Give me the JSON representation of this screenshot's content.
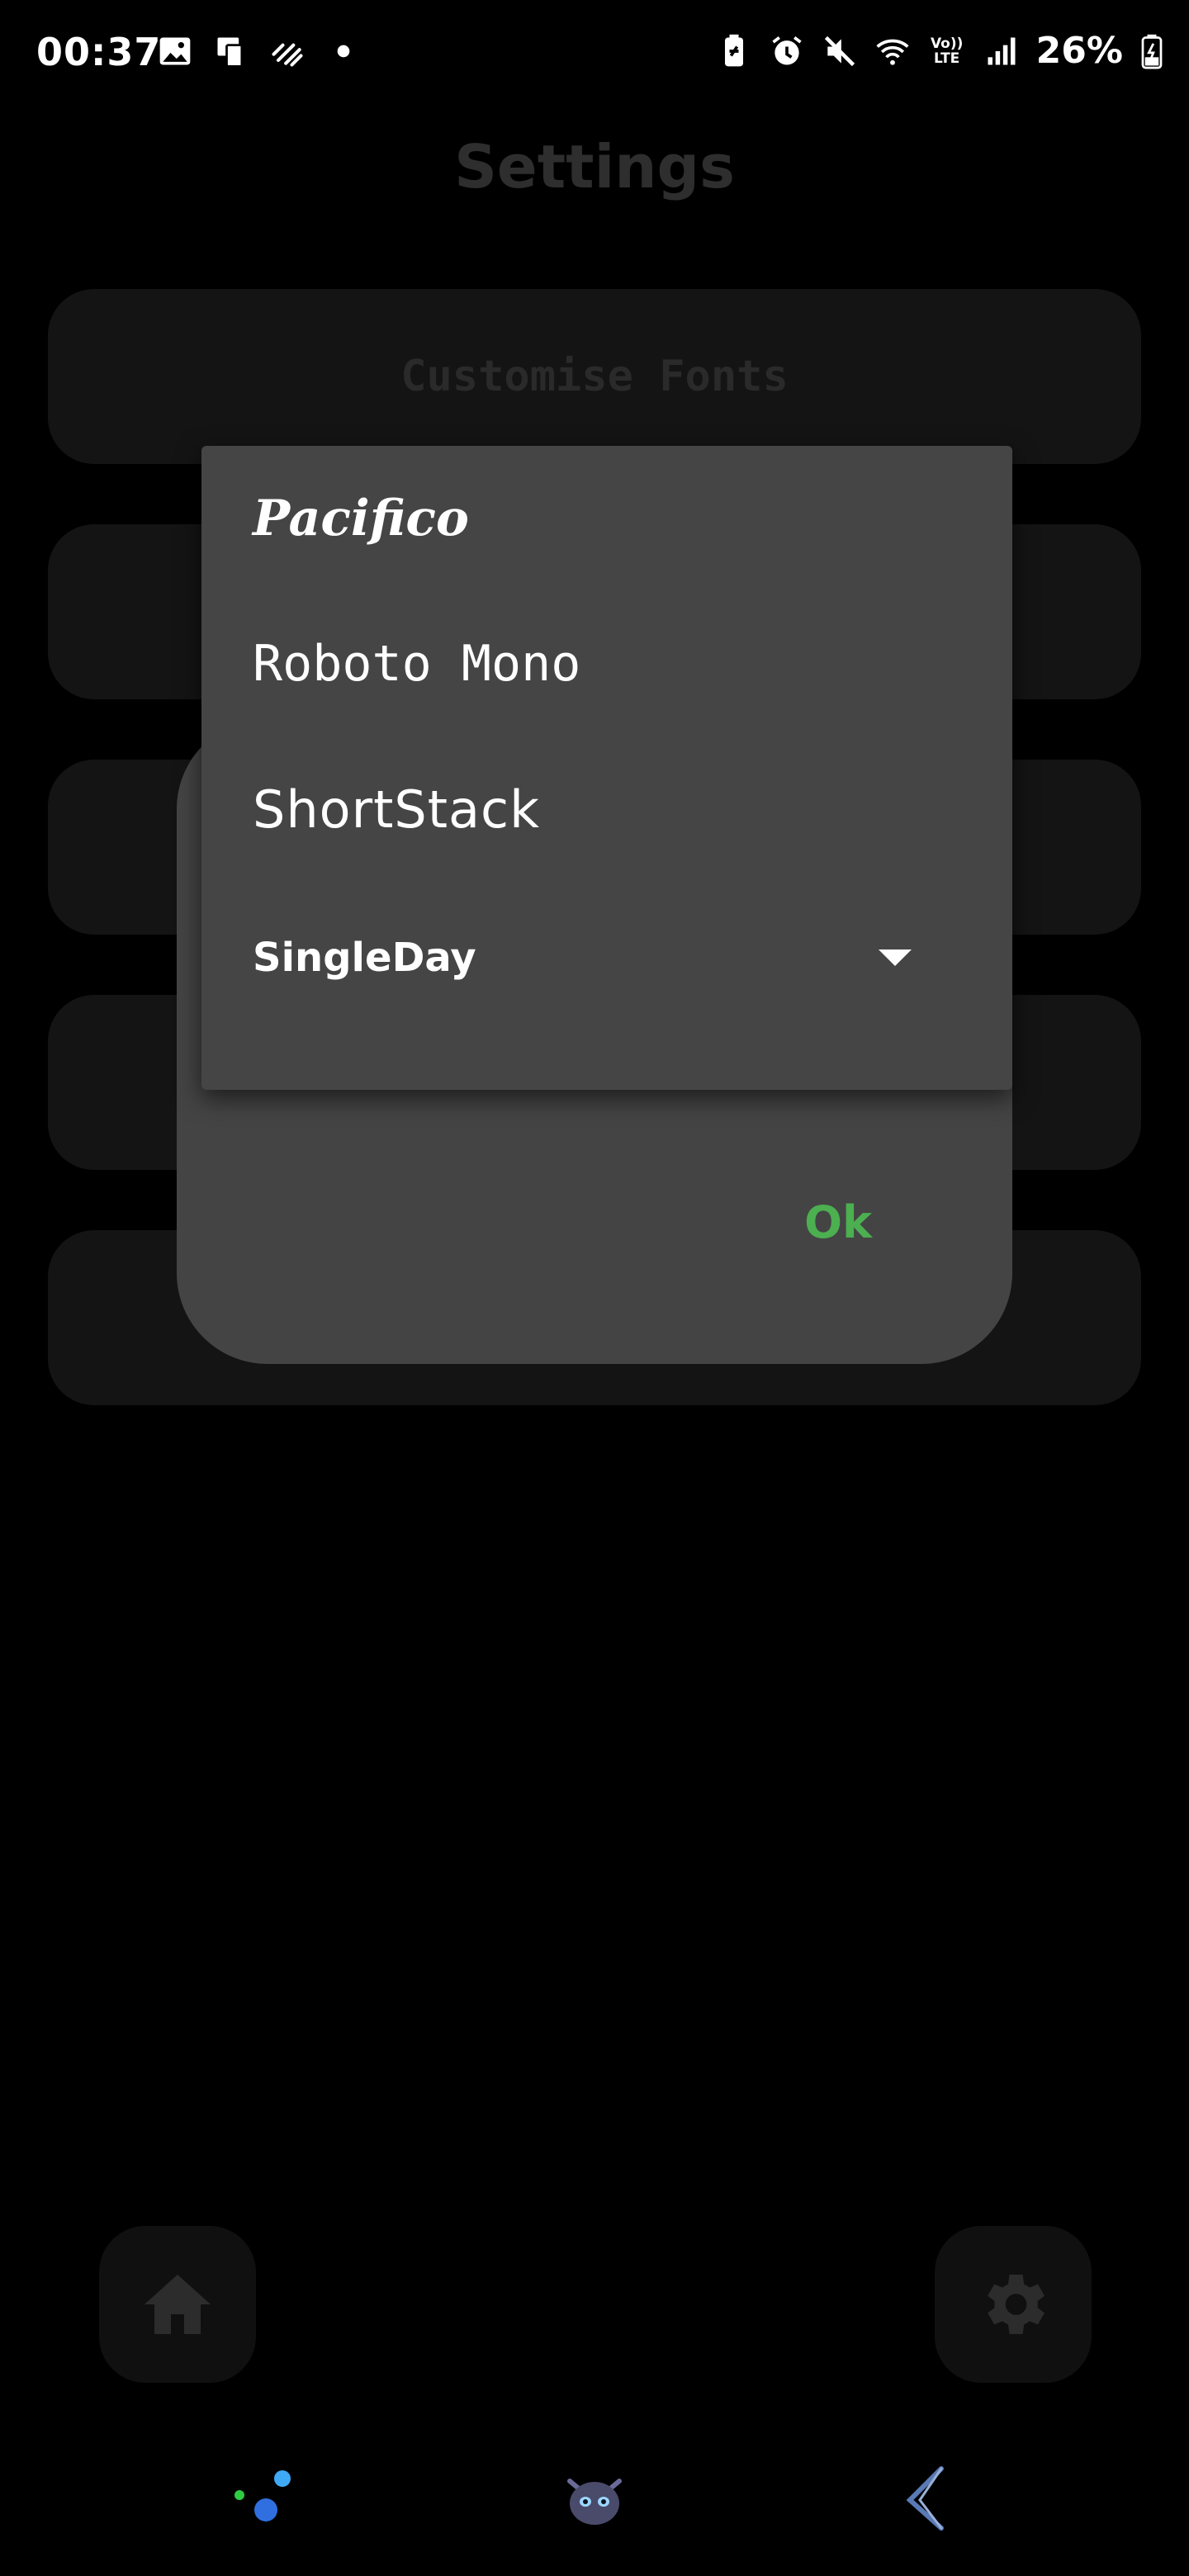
{
  "status_bar": {
    "time": "00:37",
    "battery": "26%",
    "left_icons": [
      "image-icon",
      "screen-mirror-icon",
      "data-saver-icon",
      "dot-icon"
    ],
    "right_icons": [
      "battery-saver-icon",
      "alarm-icon",
      "mute-icon",
      "wifi-icon",
      "volte-icon",
      "signal-icon",
      "battery-icon"
    ],
    "volte_label": "Vo)) LTE"
  },
  "page": {
    "title": "Settings",
    "cards": [
      {
        "label": "Customise Fonts"
      },
      {
        "label": ""
      },
      {
        "label": ""
      },
      {
        "label": ""
      },
      {
        "label": ""
      }
    ]
  },
  "dialog": {
    "ok_label": "Ok"
  },
  "dropdown": {
    "options": [
      {
        "label": "Pacifico"
      },
      {
        "label": "Roboto Mono"
      },
      {
        "label": "ShortStack"
      },
      {
        "label": "SingleDay"
      }
    ],
    "selected": "SingleDay"
  },
  "bottom_buttons": {
    "home": "home-icon",
    "settings": "gear-icon"
  },
  "dock": [
    "dots-icon",
    "dragon-icon",
    "back-icon"
  ],
  "colors": {
    "background": "#000000",
    "dialog": "#444444",
    "accent_ok": "#4caf50"
  }
}
